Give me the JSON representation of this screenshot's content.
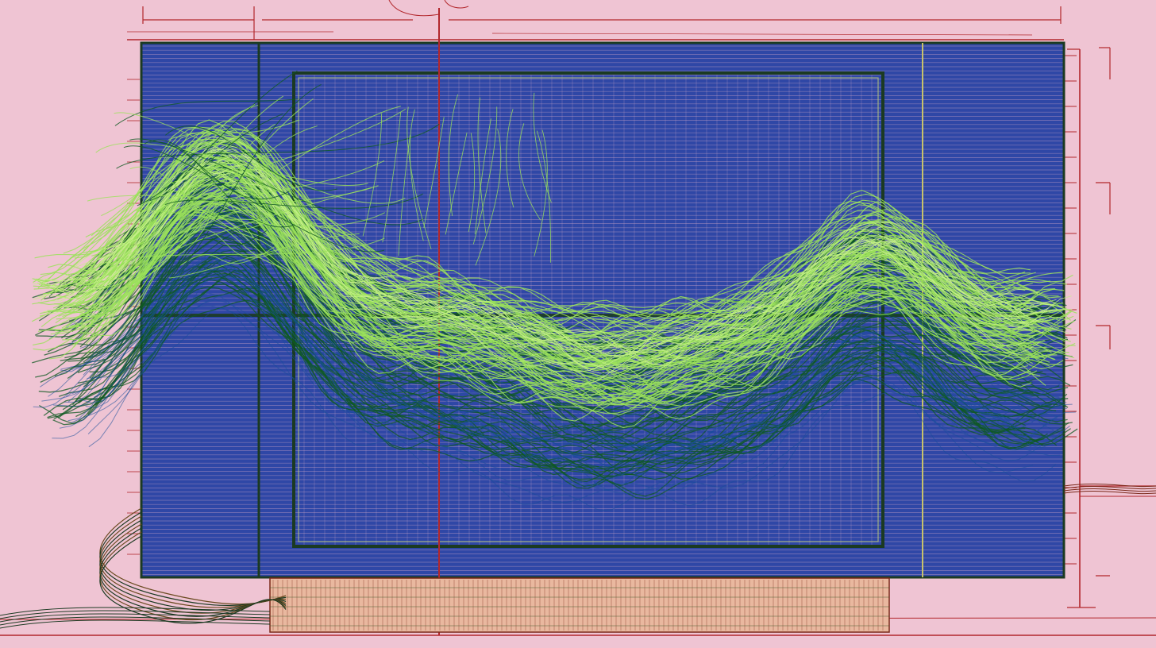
{
  "artwork": {
    "subject": "blueprint-monitor-with-green-waveform",
    "colors": {
      "background": "#efc4d3",
      "screen": "#2f47a6",
      "screen_grid": "#c9a3c6",
      "frame_dark": "#1b3a22",
      "frame_red": "#b2272c",
      "wave_light": "#9be25a",
      "wave_dark": "#0f5a22",
      "base_fill": "#e9b89f",
      "base_line": "#7a2a1a"
    }
  }
}
